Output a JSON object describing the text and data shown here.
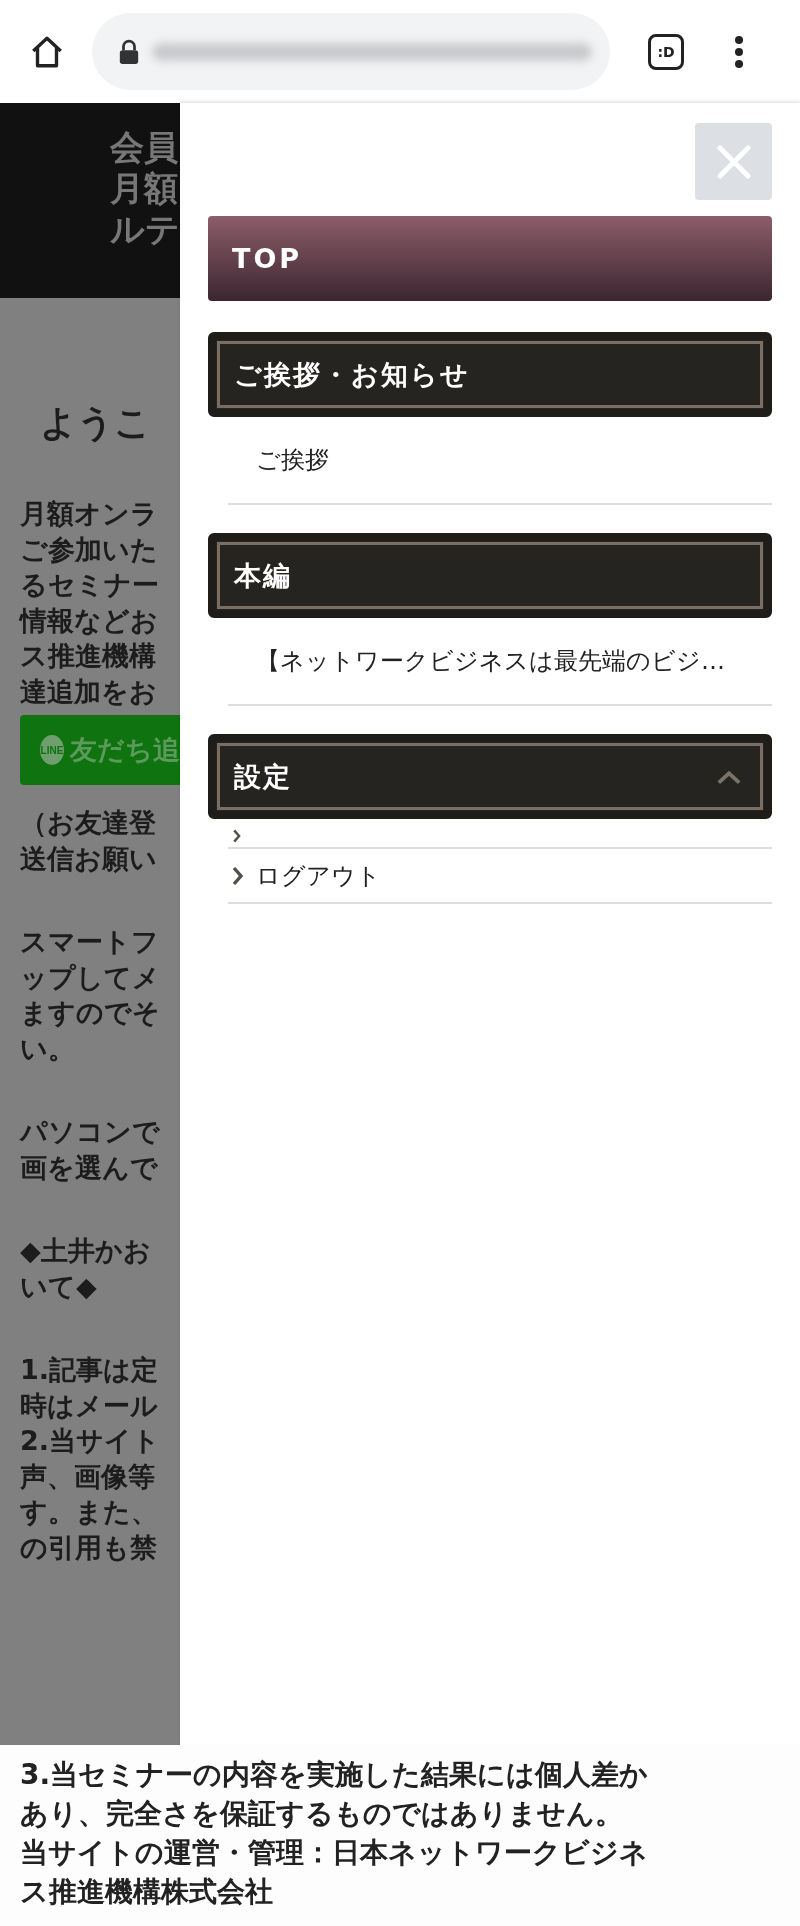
{
  "browser": {
    "tab_switcher": ":D"
  },
  "page": {
    "header_lines": [
      "会員",
      "月額",
      "ルテ"
    ],
    "heading": "ようこ",
    "blocks": [
      {
        "kind": "text",
        "lines": [
          "月額オンラ",
          "ご参加いた",
          "るセミナー",
          "情報などお",
          "ス推進機構",
          "達追加をお"
        ]
      },
      {
        "kind": "line_button",
        "badge": "LINE",
        "label": "友だち追"
      },
      {
        "kind": "text",
        "lines": [
          "（お友達登",
          "送信お願い"
        ]
      },
      {
        "kind": "text",
        "lines": [
          "スマートフ",
          "ップしてメ",
          "ますのでそ",
          "い。"
        ]
      },
      {
        "kind": "text",
        "lines": [
          "パソコンで",
          "画を選んで"
        ]
      },
      {
        "kind": "text",
        "lines": [
          "◆土井かお",
          "いて◆"
        ]
      },
      {
        "kind": "text",
        "lines": [
          "1.記事は定",
          "時はメール",
          "2.当サイト",
          "声、画像等",
          "す。また、",
          "の引用も禁"
        ]
      }
    ],
    "footer_lines": [
      "3.当セミナーの内容を実施した結果には個人差か",
      "あり、完全さを保証するものではありません。",
      "当サイトの運営・管理：日本ネットワークビジネ",
      "ス推進機構株式会社"
    ]
  },
  "drawer": {
    "menu": [
      {
        "kind": "top",
        "label": "TOP"
      },
      {
        "kind": "section",
        "label": "ご挨拶・お知らせ",
        "chevron": false
      },
      {
        "kind": "item",
        "label": "ご挨拶",
        "chevron": false
      },
      {
        "kind": "section",
        "label": "本編",
        "chevron": false
      },
      {
        "kind": "item",
        "label": "【ネットワークビジネスは最先端のビジ…",
        "chevron": false
      },
      {
        "kind": "section",
        "label": "設定",
        "chevron": true
      },
      {
        "kind": "item",
        "chevron": true
      },
      {
        "kind": "item",
        "label": "ログアウト",
        "chevron": true
      }
    ]
  }
}
